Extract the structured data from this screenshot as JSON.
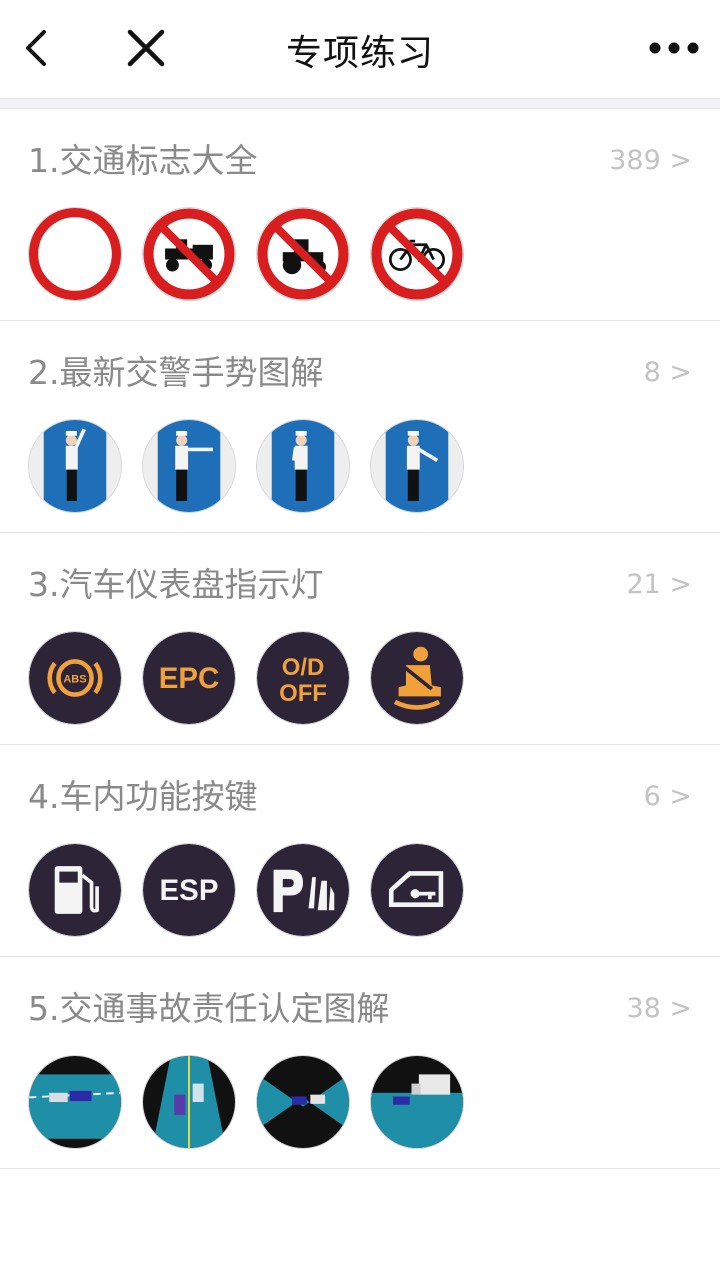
{
  "header": {
    "title": "专项练习",
    "back_icon": "back-arrow-icon",
    "close_icon": "close-icon",
    "more_icon": "more-dots-icon"
  },
  "sections": [
    {
      "title": "1.交通标志大全",
      "count": "389 >",
      "thumbs": [
        "no-entry-sign-icon",
        "no-tricycle-sign-icon",
        "no-tractor-sign-icon",
        "no-bicycle-sign-icon"
      ]
    },
    {
      "title": "2.最新交警手势图解",
      "count": "8 >",
      "thumbs": [
        "police-gesture-stop-icon",
        "police-gesture-straight-icon",
        "police-gesture-left-turn-icon",
        "police-gesture-right-turn-icon"
      ]
    },
    {
      "title": "3.汽车仪表盘指示灯",
      "count": "21 >",
      "thumbs": [
        "abs-light-icon",
        "epc-light-icon",
        "od-off-light-icon",
        "seatbelt-light-icon"
      ],
      "labels": [
        "ABS",
        "EPC",
        "O/D",
        "OFF"
      ]
    },
    {
      "title": "4.车内功能按键",
      "count": "6 >",
      "thumbs": [
        "fuel-pump-icon",
        "esp-button-icon",
        "parking-sensor-icon",
        "door-lock-icon"
      ],
      "labels": [
        "ESP"
      ]
    },
    {
      "title": "5.交通事故责任认定图解",
      "count": "38 >",
      "thumbs": [
        "accident-scene-1-icon",
        "accident-scene-2-icon",
        "accident-scene-3-icon",
        "accident-scene-4-icon"
      ]
    }
  ],
  "colors": {
    "sign_red": "#d81e1e",
    "dash_bg": "#2d2438",
    "dash_amber": "#f0a13a",
    "police_blue": "#1e6fb8",
    "road_teal": "#1f8fa8"
  }
}
